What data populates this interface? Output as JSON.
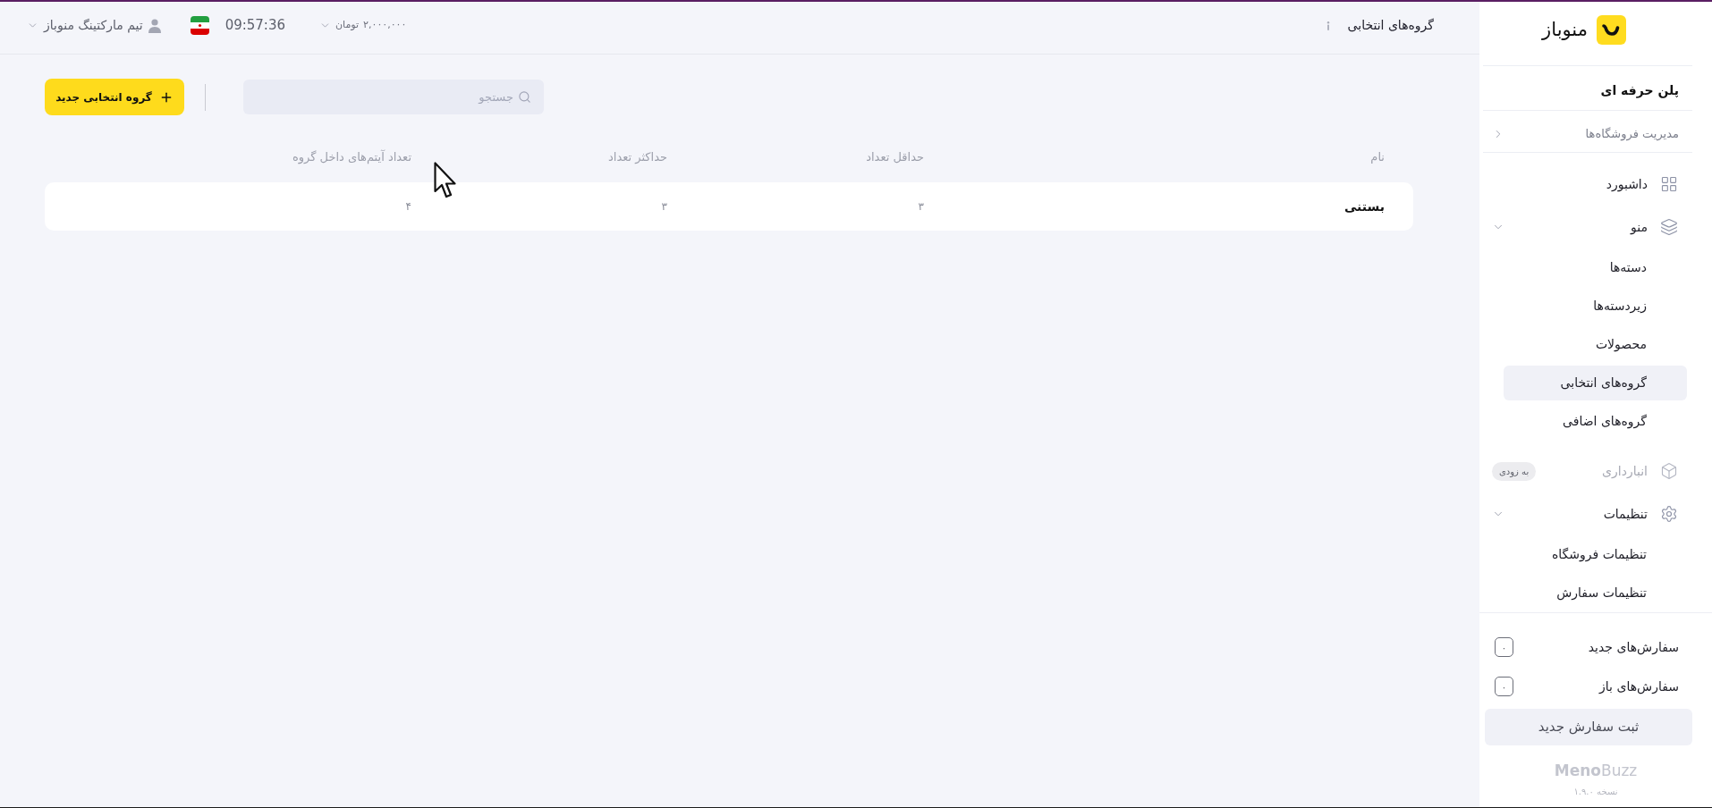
{
  "header": {
    "title": "گروه‌های انتخابی",
    "balance": {
      "amount": "۲,۰۰۰,۰۰۰",
      "currency": "تومان"
    },
    "time": "09:57:36",
    "user": "تیم مارکتینگ منوباز"
  },
  "toolbar": {
    "search": {
      "placeholder": "جستجو"
    },
    "add_button": "گروه انتخابی جدید"
  },
  "table": {
    "columns": [
      "نام",
      "حداقل تعداد",
      "حداکثر تعداد",
      "تعداد آیتم‌های داخل گروه"
    ],
    "rows": [
      [
        "بستنی",
        "۳",
        "۳",
        "۴"
      ]
    ]
  },
  "sidebar": {
    "brand": "منوباز",
    "plan": "پلن حرفه ای",
    "store_manager": "مدیریت فروشگاه‌ها",
    "nav": [
      {
        "kind": "link",
        "label": "داشبورد",
        "disabled": false
      },
      {
        "kind": "group",
        "label": "منو",
        "disabled": false,
        "expanded": true,
        "children": [
          {
            "label": "دسته‌ها",
            "selected": false
          },
          {
            "label": "زیردسته‌ها",
            "selected": false
          },
          {
            "label": "محصولات",
            "selected": false
          },
          {
            "label": "گروه‌های انتخابی",
            "selected": true
          },
          {
            "label": "گروه‌های اضافی",
            "selected": false
          }
        ]
      },
      {
        "kind": "link",
        "label": "انبارداری",
        "disabled": true,
        "badge": "به زودی"
      },
      {
        "kind": "group",
        "label": "تنظیمات",
        "disabled": false,
        "expanded": true,
        "children": [
          {
            "label": "تنظیمات فروشگاه",
            "selected": false
          },
          {
            "label": "تنظیمات سفارش",
            "selected": false
          }
        ]
      }
    ],
    "order_counters": [
      {
        "label": "سفارش‌های جدید",
        "count": "۰"
      },
      {
        "label": "سفارش‌های باز",
        "count": "۰"
      }
    ],
    "new_order_button": "ثبت سفارش جدید",
    "wordmark": "**Meno**Buzz",
    "version": "نسخه ۱.۹.۰"
  }
}
